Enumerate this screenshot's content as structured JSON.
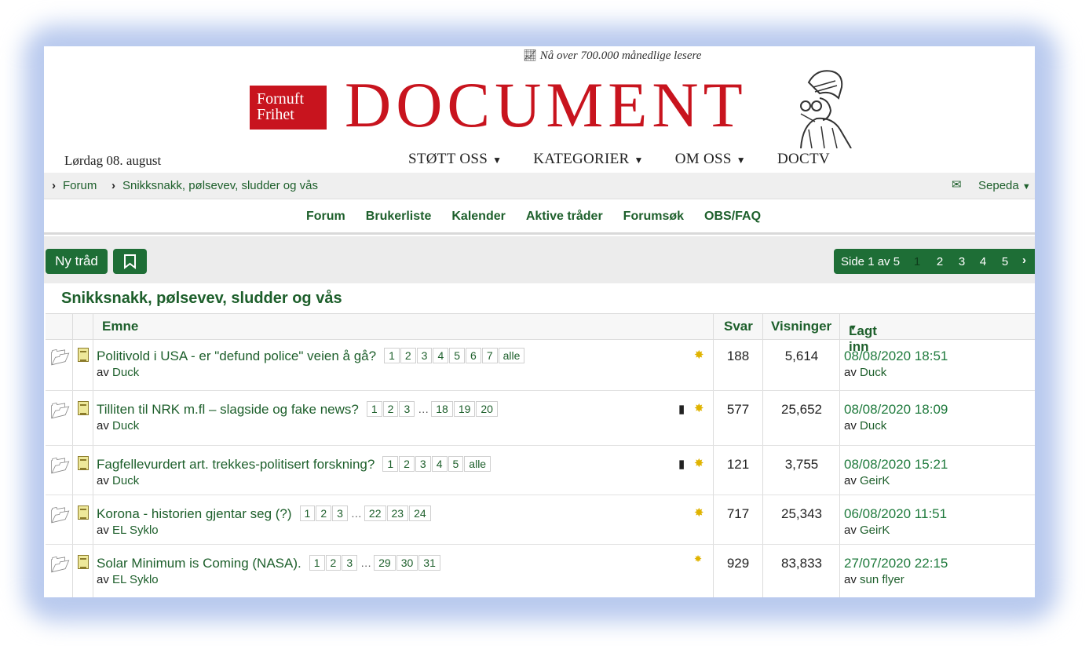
{
  "masthead": {
    "tagline": "Nå over 700.000 månedlige lesere",
    "tagline_icon": "trend-chart-icon",
    "logo_box_line1": "Fornuft",
    "logo_box_line2": "Frihet",
    "logo_word": "DOCUMENT",
    "brand_color": "#c8141e",
    "date": "Lørdag 08. august",
    "nav": [
      "STØTT OSS",
      "KATEGORIER",
      "OM OSS",
      "DOCTV"
    ]
  },
  "breadcrumb": {
    "items": [
      "Forum",
      "Snikksnakk, pølsevev, sludder og vås"
    ],
    "user": "Sepeda"
  },
  "forum_nav": [
    "Forum",
    "Brukerliste",
    "Kalender",
    "Aktive tråder",
    "Forumsøk",
    "OBS/FAQ"
  ],
  "actions": {
    "new_thread": "Ny tråd",
    "pager_label": "Side 1 av 5",
    "pages": [
      "1",
      "2",
      "3",
      "4",
      "5"
    ],
    "accent": "#1e6e36"
  },
  "forum": {
    "title": "Snikksnakk, pølsevev, sludder og vås",
    "columns": {
      "topic": "Emne",
      "replies": "Svar",
      "views": "Visninger",
      "last": "Lagt inn"
    },
    "by_prefix": "av",
    "threads": [
      {
        "title": "Politivold i USA - er \"defund police\" veien å gå?",
        "pages": [
          "1",
          "2",
          "3",
          "4",
          "5",
          "6",
          "7",
          "alle"
        ],
        "author": "Duck",
        "replies": "188",
        "views": "5,614",
        "last_date": "08/08/2020 18:51",
        "last_author": "Duck",
        "bookmarked": false
      },
      {
        "title": "Tilliten til NRK m.fl – slagside og fake news?",
        "pages": [
          "1",
          "2",
          "3",
          "…",
          "18",
          "19",
          "20"
        ],
        "author": "Duck",
        "replies": "577",
        "views": "25,652",
        "last_date": "08/08/2020 18:09",
        "last_author": "Duck",
        "bookmarked": true
      },
      {
        "title": "Fagfellevurdert art. trekkes-politisert forskning?",
        "pages": [
          "1",
          "2",
          "3",
          "4",
          "5",
          "alle"
        ],
        "author": "Duck",
        "replies": "121",
        "views": "3,755",
        "last_date": "08/08/2020 15:21",
        "last_author": "GeirK",
        "bookmarked": true
      },
      {
        "title": "Korona - historien gjentar seg (?)",
        "pages": [
          "1",
          "2",
          "3",
          "…",
          "22",
          "23",
          "24"
        ],
        "author": "EL Syklo",
        "replies": "717",
        "views": "25,343",
        "last_date": "06/08/2020 11:51",
        "last_author": "GeirK",
        "bookmarked": false
      },
      {
        "title": "Solar Minimum is Coming (NASA).",
        "pages": [
          "1",
          "2",
          "3",
          "…",
          "29",
          "30",
          "31"
        ],
        "author": "EL Syklo",
        "replies": "929",
        "views": "83,833",
        "last_date": "27/07/2020 22:15",
        "last_author": "sun flyer",
        "bookmarked": false
      }
    ]
  }
}
